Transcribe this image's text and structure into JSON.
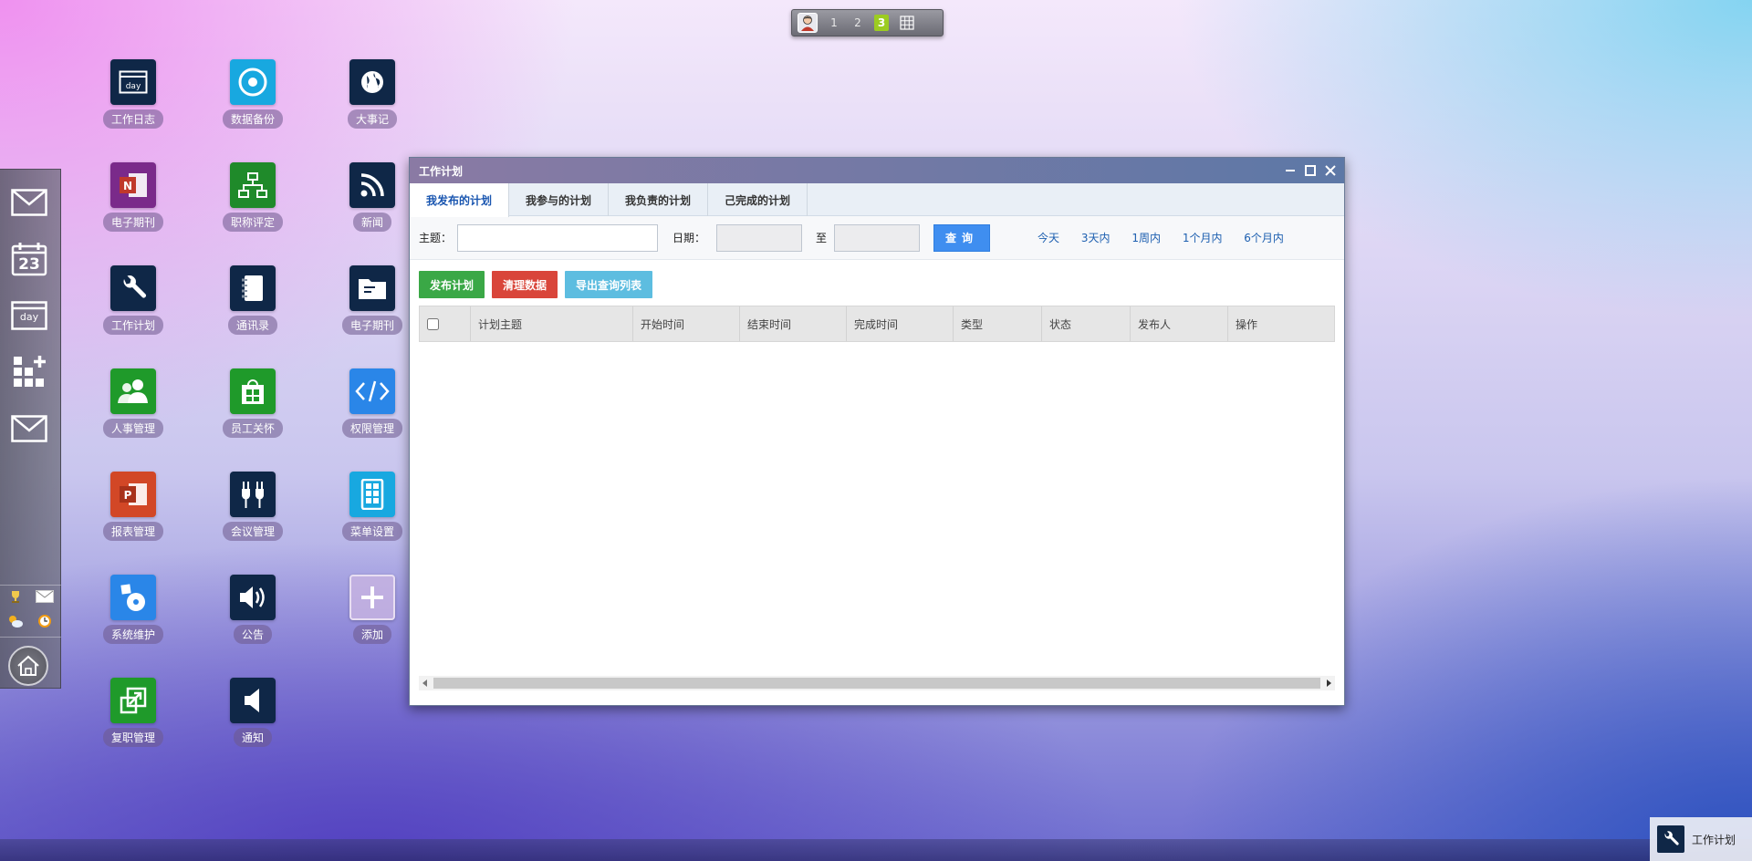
{
  "pager": {
    "pages": [
      "1",
      "2",
      "3"
    ],
    "active_page": "3"
  },
  "dock": {
    "buttons": [
      "mail-icon",
      "calendar-icon",
      "day-icon",
      "apps-icon",
      "mail-icon"
    ],
    "calendar_day": "23",
    "day_text": "day"
  },
  "desktop": {
    "icons": [
      {
        "label": "工作日志",
        "color": "#0f2747",
        "icon": "day-icon"
      },
      {
        "label": "数据备份",
        "color": "#18a8e0",
        "icon": "disk-icon"
      },
      {
        "label": "大事记",
        "color": "#0f2747",
        "icon": "globe-icon"
      },
      {
        "label": "电子期刊",
        "color": "#7a2a8a",
        "icon": "onenote-icon"
      },
      {
        "label": "职称评定",
        "color": "#1f8a2a",
        "icon": "org-chart-icon"
      },
      {
        "label": "新闻",
        "color": "#0f2747",
        "icon": "rss-icon"
      },
      {
        "label": "工作计划",
        "color": "#0f2747",
        "icon": "wrench-icon"
      },
      {
        "label": "通讯录",
        "color": "#0f2747",
        "icon": "contacts-icon"
      },
      {
        "label": "电子期刊",
        "color": "#0f2747",
        "icon": "folder-icon"
      },
      {
        "label": "人事管理",
        "color": "#1f9a2a",
        "icon": "people-icon"
      },
      {
        "label": "员工关怀",
        "color": "#1f9a2a",
        "icon": "store-icon"
      },
      {
        "label": "权限管理",
        "color": "#2a86e8",
        "icon": "code-icon"
      },
      {
        "label": "报表管理",
        "color": "#d24726",
        "icon": "powerpoint-icon"
      },
      {
        "label": "会议管理",
        "color": "#0f2747",
        "icon": "plug-icon"
      },
      {
        "label": "菜单设置",
        "color": "#18a8e0",
        "icon": "menu-tablet-icon"
      },
      {
        "label": "系统维护",
        "color": "#2a86e8",
        "icon": "install-icon"
      },
      {
        "label": "公告",
        "color": "#0f2747",
        "icon": "speaker-icon"
      },
      {
        "label": "添加",
        "color": "#b9a6d6",
        "icon": "plus-icon"
      },
      {
        "label": "复职管理",
        "color": "#1f9a2a",
        "icon": "resize-icon"
      },
      {
        "label": "通知",
        "color": "#0f2747",
        "icon": "volume-icon"
      }
    ]
  },
  "window": {
    "title": "工作计划",
    "tabs": [
      "我发布的计划",
      "我参与的计划",
      "我负责的计划",
      "己完成的计划"
    ],
    "active_tab": 0,
    "query": {
      "subject_label": "主题：",
      "subject_value": "",
      "date_label": "日期：",
      "to_label": "至",
      "search_label": "查询",
      "quick_ranges": [
        "今天",
        "3天内",
        "1周内",
        "1个月内",
        "6个月内"
      ]
    },
    "actions": [
      "发布计划",
      "清理数据",
      "导出查询列表"
    ],
    "table": {
      "columns": [
        "计划主题",
        "开始时间",
        "结束时间",
        "完成时间",
        "类型",
        "状态",
        "发布人",
        "操作"
      ]
    }
  },
  "taskbar": {
    "item_label": "工作计划"
  },
  "colors": {
    "accent_blue": "#3f8ef0",
    "tab_active_text": "#1a56b0",
    "btn_green": "#3aa846",
    "btn_red": "#d9453a",
    "btn_cyan": "#5dbde0",
    "pager_active": "#9ccc21"
  }
}
